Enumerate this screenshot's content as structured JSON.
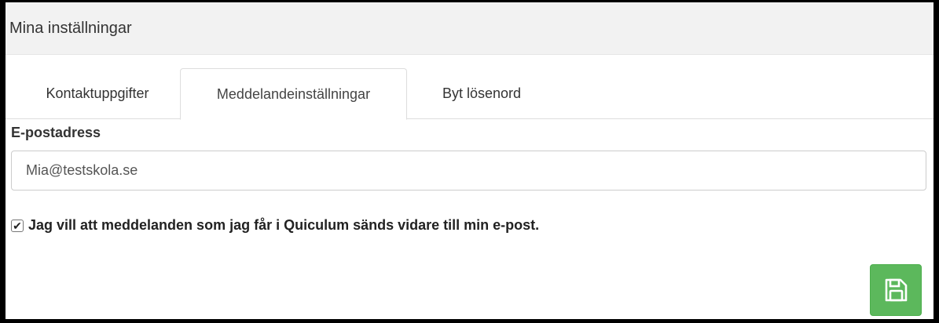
{
  "panel": {
    "title": "Mina inställningar"
  },
  "tabs": [
    {
      "label": "Kontaktuppgifter",
      "active": false
    },
    {
      "label": "Meddelandeinställningar",
      "active": true
    },
    {
      "label": "Byt lösenord",
      "active": false
    }
  ],
  "form": {
    "email_label": "E-postadress",
    "email_value": "Mia@testskola.se",
    "forward_checkbox_checked": true,
    "forward_checkbox_label": "Jag vill att meddelanden som jag får i Quiculum sänds vidare till min e-post.",
    "save_button_icon": "floppy-disk-icon"
  },
  "colors": {
    "save_button": "#5cb85c",
    "heading_background": "#f2f2f2"
  }
}
